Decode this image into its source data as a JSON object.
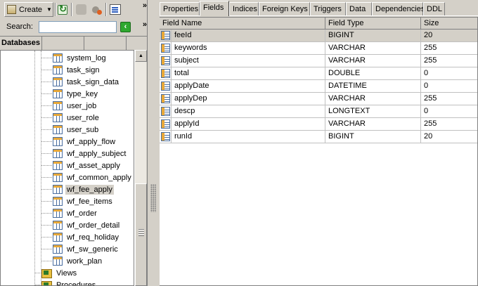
{
  "toolbar": {
    "create_label": "Create",
    "create_icon": "database-icon",
    "refresh_icon": "refresh-icon",
    "more": "»"
  },
  "search": {
    "label": "Search:",
    "value": "",
    "go_icon": "go-arrow-icon",
    "more": "»"
  },
  "panel": {
    "tab_label": "Databases"
  },
  "tree": {
    "items": [
      {
        "label": "system_log"
      },
      {
        "label": "task_sign"
      },
      {
        "label": "task_sign_data"
      },
      {
        "label": "type_key"
      },
      {
        "label": "user_job"
      },
      {
        "label": "user_role"
      },
      {
        "label": "user_sub"
      },
      {
        "label": "wf_apply_flow"
      },
      {
        "label": "wf_apply_subject"
      },
      {
        "label": "wf_asset_apply"
      },
      {
        "label": "wf_common_apply"
      },
      {
        "label": "wf_fee_apply"
      },
      {
        "label": "wf_fee_items"
      },
      {
        "label": "wf_order"
      },
      {
        "label": "wf_order_detail"
      },
      {
        "label": "wf_req_holiday"
      },
      {
        "label": "wf_sw_generic"
      },
      {
        "label": "work_plan"
      }
    ],
    "selected": "wf_fee_apply",
    "folders": [
      {
        "label": "Views"
      },
      {
        "label": "Procedures"
      }
    ]
  },
  "tabs": [
    "Properties",
    "Fields",
    "Indices",
    "Foreign Keys",
    "Triggers",
    "Data",
    "Dependencies",
    "DDL"
  ],
  "active_tab": "Fields",
  "grid": {
    "headers": [
      "Field Name",
      "Field Type",
      "Size"
    ],
    "rows": [
      {
        "name": "feeId",
        "type": "BIGINT",
        "size": "20"
      },
      {
        "name": "keywords",
        "type": "VARCHAR",
        "size": "255"
      },
      {
        "name": "subject",
        "type": "VARCHAR",
        "size": "255"
      },
      {
        "name": "total",
        "type": "DOUBLE",
        "size": "0"
      },
      {
        "name": "applyDate",
        "type": "DATETIME",
        "size": "0"
      },
      {
        "name": "applyDep",
        "type": "VARCHAR",
        "size": "255"
      },
      {
        "name": "descp",
        "type": "LONGTEXT",
        "size": "0"
      },
      {
        "name": "applyId",
        "type": "VARCHAR",
        "size": "255"
      },
      {
        "name": "runId",
        "type": "BIGINT",
        "size": "20"
      }
    ]
  }
}
